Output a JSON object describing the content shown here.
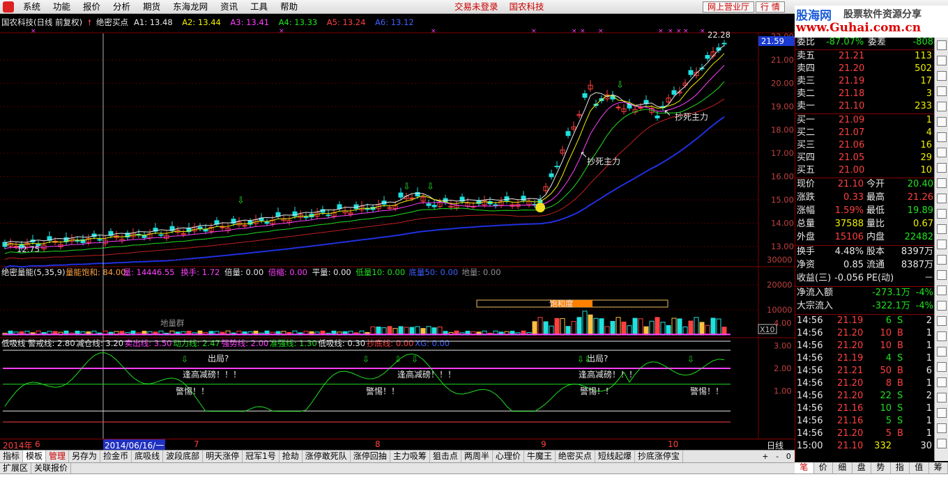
{
  "menu": {
    "items": [
      "系统",
      "功能",
      "报价",
      "分析",
      "期货",
      "东海龙网",
      "资讯",
      "工具",
      "帮助"
    ],
    "center": [
      "交易未登录",
      "国农科技"
    ],
    "login_label": "网上营业厅",
    "quote_label": "行 情"
  },
  "site_logo": {
    "brand": "股海网",
    "slogan": "股票软件资源分享",
    "url": "www.Guhai.com.cn"
  },
  "main_chart": {
    "header_title": "国农科技(日线 前复权)",
    "indicator_name": "绝密买点",
    "ma_labels": [
      {
        "text": "A1: 13.48",
        "color": "#e8e8e8"
      },
      {
        "text": "A2: 13.44",
        "color": "#f0f000"
      },
      {
        "text": "A3: 13.41",
        "color": "#ff40ff"
      },
      {
        "text": "A4: 13.33",
        "color": "#20e020"
      },
      {
        "text": "A5: 13.24",
        "color": "#ff4040"
      },
      {
        "text": "A6: 13.12",
        "color": "#4060ff"
      }
    ],
    "price_ticks": [
      "21.00",
      "20.00",
      "19.00",
      "18.00",
      "17.00",
      "16.00",
      "15.00",
      "14.00",
      "13.00"
    ],
    "top_tick": "22.00",
    "current_price_tag": "21.59",
    "high_label": "22.28",
    "low_label": "12.75",
    "annotations": [
      "抄死主力",
      "抄死主力"
    ]
  },
  "vol_panel": {
    "title": "绝密量能(5,35,9)",
    "items": [
      {
        "text": "量能饱和: 84.00",
        "color": "#ffa040"
      },
      {
        "text": "量: 14446.55",
        "color": "#ff40ff"
      },
      {
        "text": "换手: 1.72",
        "color": "#ff40ff"
      },
      {
        "text": "倍量: 0.00",
        "color": "#e8e8e8"
      },
      {
        "text": "倍缩: 0.00",
        "color": "#ff40ff"
      },
      {
        "text": "平量: 0.00",
        "color": "#e8e8e8"
      },
      {
        "text": "低量10: 0.00",
        "color": "#20e020"
      },
      {
        "text": "底量50: 0.00",
        "color": "#4060ff"
      },
      {
        "text": "地量: 0.00",
        "color": "#909090"
      }
    ],
    "ticks": [
      "30000",
      "20000",
      "10000"
    ],
    "unit": "X10",
    "label_saturation": "饱和度",
    "label_ground": "地量群"
  },
  "osc_panel": {
    "title": "低吸线",
    "items": [
      {
        "text": "警戒线: 2.80",
        "color": "#e8e8e8"
      },
      {
        "text": "减仓线: 3.20",
        "color": "#e8e8e8"
      },
      {
        "text": "卖出线: 3.50",
        "color": "#ff40ff"
      },
      {
        "text": "动力线: 2.47",
        "color": "#20e020"
      },
      {
        "text": "强势线: 2.00",
        "color": "#ff40ff"
      },
      {
        "text": "准强线: 1.30",
        "color": "#20e020"
      },
      {
        "text": "低吸线: 0.30",
        "color": "#e8e8e8"
      },
      {
        "text": "抄底线: 0.00",
        "color": "#ff4040"
      },
      {
        "text": "XG: 0.00",
        "color": "#4060ff"
      }
    ],
    "ticks": [
      "4.00",
      "3.00",
      "2.00",
      "1.00"
    ],
    "label_exit": "出局?",
    "label_reduce": "逢高减磅！！！",
    "label_alert": "警惕！！"
  },
  "time_axis": {
    "year": "2014年",
    "months": [
      "6",
      "7",
      "8",
      "9",
      "10"
    ],
    "cursor_date": "2014/06/16/一",
    "period": "日线"
  },
  "quote": {
    "wei_bi": {
      "label": "委比",
      "value": "-87.07%",
      "label2": "委差",
      "value2": "-808"
    },
    "asks": [
      {
        "label": "卖五",
        "price": "21.21",
        "vol": "113"
      },
      {
        "label": "卖四",
        "price": "21.20",
        "vol": "502"
      },
      {
        "label": "卖三",
        "price": "21.19",
        "vol": "17"
      },
      {
        "label": "卖二",
        "price": "21.18",
        "vol": "3"
      },
      {
        "label": "卖一",
        "price": "21.10",
        "vol": "233"
      }
    ],
    "bids": [
      {
        "label": "买一",
        "price": "21.09",
        "vol": "1"
      },
      {
        "label": "买二",
        "price": "21.07",
        "vol": "4"
      },
      {
        "label": "买三",
        "price": "21.06",
        "vol": "16"
      },
      {
        "label": "买四",
        "price": "21.05",
        "vol": "29"
      },
      {
        "label": "买五",
        "price": "21.00",
        "vol": "10"
      }
    ],
    "stats": [
      {
        "l1": "现价",
        "v1": "21.10",
        "c1": "#ff4040",
        "l2": "今开",
        "v2": "20.40",
        "c2": "#20e020"
      },
      {
        "l1": "涨跌",
        "v1": "0.33",
        "c1": "#ff4040",
        "l2": "最高",
        "v2": "21.26",
        "c2": "#ff4040"
      },
      {
        "l1": "涨幅",
        "v1": "1.59%",
        "c1": "#ff4040",
        "l2": "最低",
        "v2": "19.89",
        "c2": "#20e020"
      },
      {
        "l1": "总量",
        "v1": "37588",
        "c1": "#f0f000",
        "l2": "量比",
        "v2": "0.67",
        "c2": "#f0f000"
      },
      {
        "l1": "外盘",
        "v1": "15106",
        "c1": "#ff4040",
        "l2": "内盘",
        "v2": "22482",
        "c2": "#20e020"
      }
    ],
    "stats2": [
      {
        "l1": "换手",
        "v1": "4.48%",
        "l2": "股本",
        "v2": "8397万"
      },
      {
        "l1": "净资",
        "v1": "0.85",
        "l2": "流通",
        "v2": "8387万"
      },
      {
        "l1": "收益(三)",
        "v1": "-0.056",
        "l2": "PE(动)",
        "v2": "－"
      }
    ],
    "flows": [
      {
        "label": "净流入额",
        "value": "-273.1万",
        "pct": "-4%"
      },
      {
        "label": "大宗流入",
        "value": "-322.1万",
        "pct": "-4%"
      }
    ],
    "ticks": [
      {
        "t": "14:56",
        "p": "21.19",
        "v": "6",
        "s": "S",
        "n": "2"
      },
      {
        "t": "14:56",
        "p": "21.20",
        "v": "10",
        "s": "B",
        "n": "1"
      },
      {
        "t": "14:56",
        "p": "21.20",
        "v": "10",
        "s": "B",
        "n": "1"
      },
      {
        "t": "14:56",
        "p": "21.19",
        "v": "4",
        "s": "S",
        "n": "1"
      },
      {
        "t": "14:56",
        "p": "21.21",
        "v": "50",
        "s": "B",
        "n": "6"
      },
      {
        "t": "14:56",
        "p": "21.20",
        "v": "8",
        "s": "B",
        "n": "1"
      },
      {
        "t": "14:56",
        "p": "21.20",
        "v": "22",
        "s": "S",
        "n": "2"
      },
      {
        "t": "14:56",
        "p": "21.16",
        "v": "10",
        "s": "S",
        "n": "1"
      },
      {
        "t": "14:56",
        "p": "21.16",
        "v": "5",
        "s": "S",
        "n": "1"
      },
      {
        "t": "14:56",
        "p": "21.20",
        "v": "5",
        "s": "B",
        "n": "1"
      },
      {
        "t": "15:00",
        "p": "21.10",
        "v": "332",
        "s": "",
        "n": "30"
      }
    ]
  },
  "formula_tabs": [
    "指标",
    "模板",
    "管理",
    "另存为",
    "捡金币",
    "底吸线",
    "波段底部",
    "明天涨停",
    "冠军1号",
    "抢劫",
    "涨停敢死队",
    "涨停回抽",
    "主力吸筹",
    "狙击点",
    "两周半",
    "心理价",
    "牛魔王",
    "绝密买点",
    "短线起爆",
    "抄底涨停宝"
  ],
  "ext_tabs": [
    "扩展区",
    "关联报价"
  ],
  "nav_controls": [
    "+",
    "-",
    "0"
  ],
  "rp_tabs": [
    "笔",
    "价",
    "细",
    "盘",
    "势",
    "指",
    "值",
    "筹"
  ],
  "colors": {
    "up": "#ff4040",
    "down": "#20e0e0",
    "grid": "#800000",
    "bg": "#000000"
  }
}
